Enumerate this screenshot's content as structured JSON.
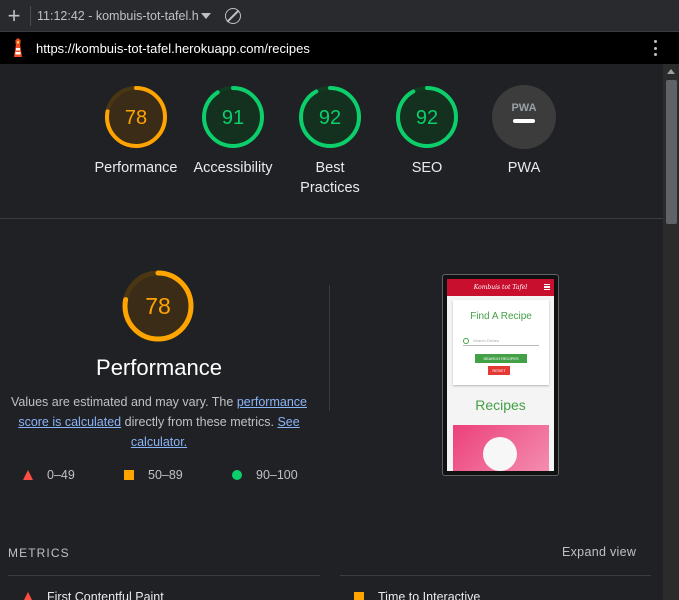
{
  "toolbar": {
    "new_report_icon": "plus-icon",
    "report_selector_text": "11:12:42 - kombuis-tot-tafel.he",
    "clear_icon": "block-icon"
  },
  "urlbar": {
    "url": "https://kombuis-tot-tafel.herokuapp.com/recipes",
    "menu_icon": "vertical-dots-icon"
  },
  "categories": [
    {
      "id": "performance",
      "label": "Performance",
      "score": "78",
      "value": 0.78,
      "rating": "average"
    },
    {
      "id": "accessibility",
      "label": "Accessibility",
      "score": "91",
      "value": 0.91,
      "rating": "pass"
    },
    {
      "id": "best-practices",
      "label": "Best Practices",
      "score": "92",
      "value": 0.92,
      "rating": "pass"
    },
    {
      "id": "seo",
      "label": "SEO",
      "score": "92",
      "value": 0.92,
      "rating": "pass"
    },
    {
      "id": "pwa",
      "label": "PWA",
      "badge": "PWA"
    }
  ],
  "performance": {
    "score": "78",
    "value": 0.78,
    "title": "Performance",
    "desc_before": "Values are estimated and may vary. The ",
    "desc_link1": "performance score is calculated",
    "desc_middle": " directly from these metrics. ",
    "desc_link2": "See calculator."
  },
  "legend": [
    {
      "range": "0–49",
      "shape": "triangle",
      "color": "#ff4e42"
    },
    {
      "range": "50–89",
      "shape": "square",
      "color": "#ffa400"
    },
    {
      "range": "90–100",
      "shape": "circle",
      "color": "#0cce6b"
    }
  ],
  "screenshot": {
    "brand": "Kombuis tot Tafel",
    "heading": "Find A Recipe",
    "search_placeholder": "Search Dishes",
    "search_button": "SEARCH RECIPES",
    "reset_button": "RESET",
    "section_title": "Recipes"
  },
  "metrics": {
    "heading": "METRICS",
    "expand": "Expand view",
    "items": [
      {
        "label": "First Contentful Paint",
        "shape": "triangle"
      },
      {
        "label": "Time to Interactive",
        "shape": "square"
      }
    ]
  },
  "colors": {
    "average": "#ffa400",
    "pass": "#0cce6b",
    "fail": "#ff4e42",
    "link": "#8ab4f8"
  }
}
